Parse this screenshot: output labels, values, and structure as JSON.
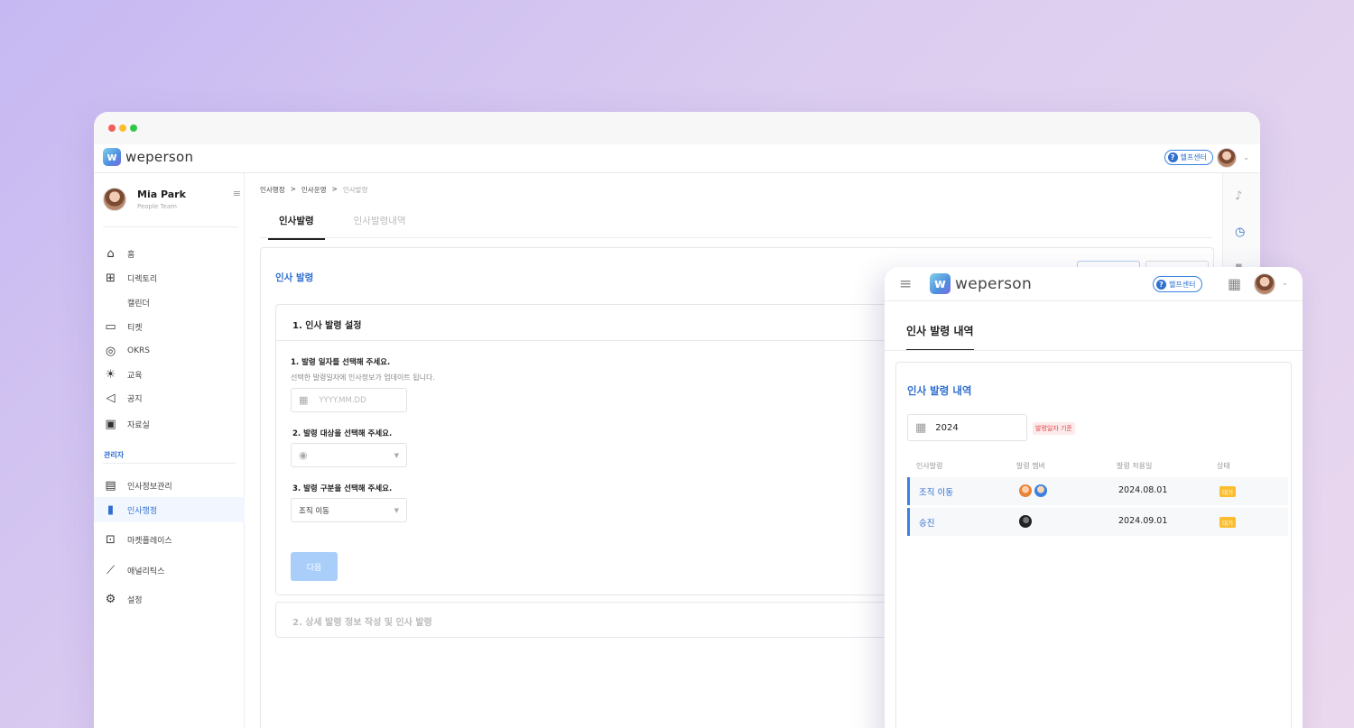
{
  "app": {
    "brand": "weperson",
    "help_label": "헬프센터"
  },
  "user": {
    "name": "Mia Park",
    "team": "People Team"
  },
  "sidebar": {
    "items": [
      {
        "label": "홈",
        "icon": "home-icon",
        "glyph": "⌂"
      },
      {
        "label": "디렉토리",
        "icon": "org-chart-icon",
        "glyph": "⊞"
      },
      {
        "label": "캘린더",
        "icon": "calendar-icon",
        "glyph": ""
      },
      {
        "label": "티켓",
        "icon": "ticket-icon",
        "glyph": "▭"
      },
      {
        "label": "OKRS",
        "icon": "target-icon",
        "glyph": "◎"
      },
      {
        "label": "교육",
        "icon": "lightbulb-icon",
        "glyph": "☀"
      },
      {
        "label": "공지",
        "icon": "megaphone-icon",
        "glyph": "◁"
      },
      {
        "label": "자료실",
        "icon": "archive-icon",
        "glyph": "▣"
      }
    ],
    "admin_label": "관리자",
    "admin_items": [
      {
        "label": "인사정보관리",
        "icon": "folder-user-icon",
        "glyph": "▤"
      },
      {
        "label": "인사행정",
        "icon": "document-icon",
        "glyph": "▮"
      },
      {
        "label": "마켓플레이스",
        "icon": "gift-icon",
        "glyph": "⊡"
      },
      {
        "label": "애널리틱스",
        "icon": "chart-line-icon",
        "glyph": "⟋"
      },
      {
        "label": "설정",
        "icon": "gear-icon",
        "glyph": "⚙"
      }
    ]
  },
  "breadcrumb": [
    "인사행정",
    "인사운영",
    "인사발령"
  ],
  "breadcrumb_sep": ">",
  "tabs": [
    "인사발령",
    "인사발령내역"
  ],
  "panel": {
    "title": "인사 발령",
    "step1_title": "1. 인사 발령 설정",
    "q1": "1. 발령 일자를 선택해 주세요.",
    "q1_sub": "선택한 발령일자에 인사정보가 업데이트 됩니다.",
    "date_placeholder": "YYYY.MM.DD",
    "q2": "2. 발령 대상을 선택해 주세요.",
    "q3": "3. 발령 구분을 선택해 주세요.",
    "type_value": "조직 이동",
    "next_label": "다음",
    "step2_title": "2. 상세 발령 정보 작성 및 인사 발령"
  },
  "overlay": {
    "tab": "인사 발령 내역",
    "title": "인사 발령 내역",
    "year": "2024",
    "badge": "발령일자 기준",
    "columns": [
      "인사발령",
      "발령 멤버",
      "발령 적용일",
      "상태"
    ],
    "rows": [
      {
        "type": "조직 이동",
        "date": "2024.08.01",
        "status": "대기"
      },
      {
        "type": "승진",
        "date": "2024.09.01",
        "status": "대기"
      }
    ]
  },
  "colors": {
    "accent": "#2f6fd0",
    "status_pending": "#fbbd2e",
    "next_disabled": "#a9cef9"
  }
}
